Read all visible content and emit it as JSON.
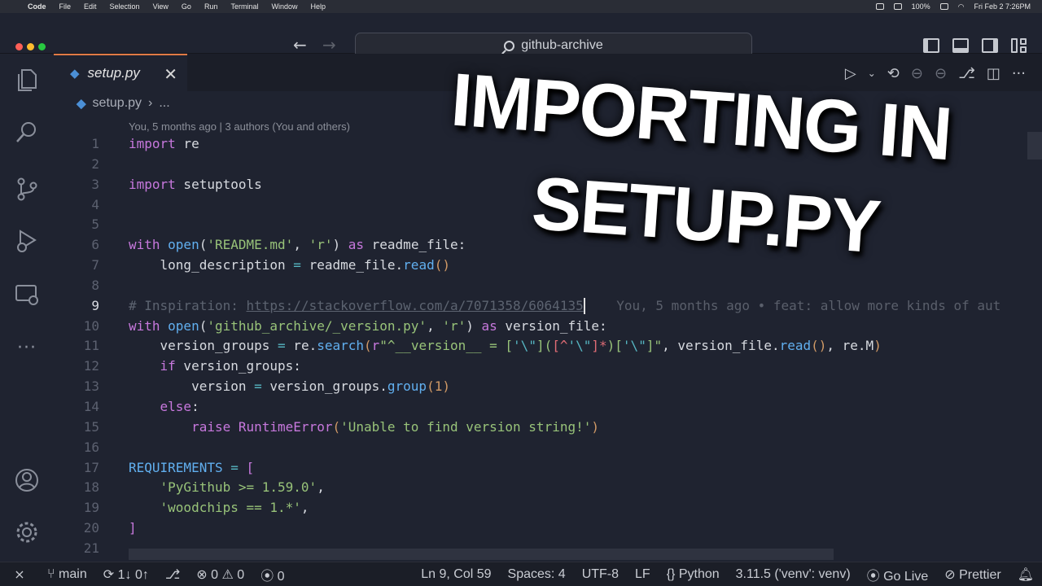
{
  "menubar": {
    "app": "Code",
    "items": [
      "File",
      "Edit",
      "Selection",
      "View",
      "Go",
      "Run",
      "Terminal",
      "Window",
      "Help"
    ],
    "battery": "100%",
    "clock": "Fri Feb 2  7:26PM"
  },
  "titlebar": {
    "search": "github-archive"
  },
  "tab": {
    "label": "setup.py",
    "icon": "python-icon"
  },
  "breadcrumb": {
    "file": "setup.py",
    "sep": "›",
    "rest": "..."
  },
  "blame_header": "You, 5 months ago | 3 authors (You and others)",
  "code": {
    "line_numbers": [
      "1",
      "2",
      "3",
      "4",
      "5",
      "6",
      "7",
      "8",
      "9",
      "10",
      "11",
      "12",
      "13",
      "14",
      "15",
      "16",
      "17",
      "18",
      "19",
      "20",
      "21"
    ],
    "l1": {
      "kw": "import",
      "id": " re"
    },
    "l3": {
      "kw": "import",
      "id": " setuptools"
    },
    "l6": {
      "kw1": "with",
      "fn": " open",
      "p1": "(",
      "s1": "'README.md'",
      "c1": ", ",
      "s2": "'r'",
      "p2": ") ",
      "kw2": "as",
      "id": " readme_file:"
    },
    "l7": {
      "indent": "    ",
      "id1": "long_description ",
      "op": "=",
      "id2": " readme_file.",
      "fn": "read",
      "p": "()"
    },
    "l9": {
      "hash": "# Inspiration: ",
      "url": "https://stackoverflow.com/a/7071358/6064135",
      "ghost": "    You, 5 months ago • feat: allow more kinds of aut"
    },
    "l10": {
      "kw1": "with",
      "fn": " open",
      "p1": "(",
      "s1": "'github_archive/_version.py'",
      "c1": ", ",
      "s2": "'r'",
      "p2": ") ",
      "kw2": "as",
      "id": " version_file:"
    },
    "l11": {
      "indent": "    ",
      "id1": "version_groups ",
      "op": "=",
      "id2": " re.",
      "fn": "search",
      "p1": "(",
      "r": "r",
      "s1": "\"^__version__ = [",
      "e1": "'\\\"",
      "s2": "](",
      "rx1": "[^",
      "e2": "'\\\"",
      "rx2": "]*",
      "s3": ")[",
      "e3": "'\\\"",
      "s4": "]\"",
      "c1": ", ",
      "id3": "version_file.",
      "fn2": "read",
      "p2": "()",
      "c2": ", ",
      "id4": "re.M",
      "p3": ")"
    },
    "l12": {
      "indent": "    ",
      "kw": "if",
      "id": " version_groups:"
    },
    "l13": {
      "indent": "        ",
      "id1": "version ",
      "op": "=",
      "id2": " version_groups.",
      "fn": "group",
      "p1": "(",
      "num": "1",
      "p2": ")"
    },
    "l14": {
      "indent": "    ",
      "kw": "else",
      "id": ":"
    },
    "l15": {
      "indent": "        ",
      "kw": "raise",
      "cls": " RuntimeError",
      "p1": "(",
      "s": "'Unable to find version string!'",
      "p2": ")"
    },
    "l17": {
      "id": "REQUIREMENTS ",
      "op": "=",
      "p": " ["
    },
    "l18": {
      "indent": "    ",
      "s": "'PyGithub >= 1.59.0'",
      "c": ","
    },
    "l19": {
      "indent": "    ",
      "s": "'woodchips == 1.*'",
      "c": ","
    },
    "l20": {
      "p": "]"
    }
  },
  "overlay": {
    "line1": "IMPORTING IN",
    "line2": "SETUP.PY"
  },
  "statusbar": {
    "branch": "main",
    "sync": "1↓ 0↑",
    "errors": "0",
    "warnings": "0",
    "ports": "0",
    "position": "Ln 9, Col 59",
    "spaces": "Spaces: 4",
    "encoding": "UTF-8",
    "eol": "LF",
    "language": "Python",
    "interpreter": "3.11.5 ('venv': venv)",
    "golive": "Go Live",
    "prettier": "Prettier"
  },
  "colors": {
    "accent_tab": "#e07a45",
    "keyword": "#c778dd",
    "function": "#61afef",
    "string": "#98c379"
  }
}
